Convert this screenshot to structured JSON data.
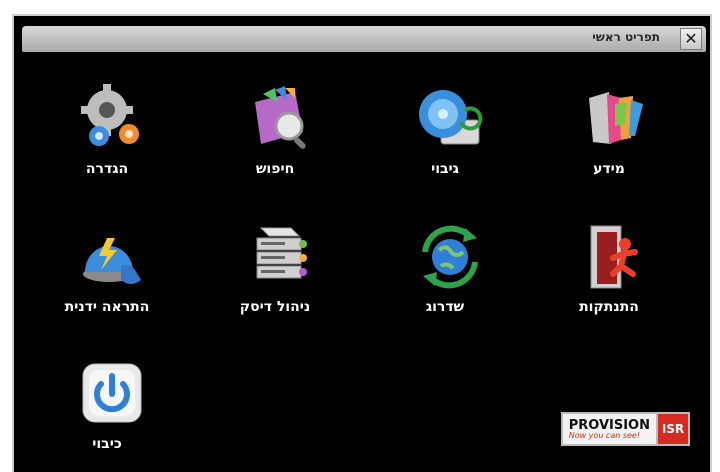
{
  "window": {
    "title": "תפריט ראשי",
    "close_glyph": "✕"
  },
  "menu": {
    "info": {
      "label": "מידע",
      "icon": "info-books-icon"
    },
    "backup": {
      "label": "גיבוי",
      "icon": "backup-disc-icon"
    },
    "search": {
      "label": "חיפוש",
      "icon": "search-magnifier-icon"
    },
    "settings": {
      "label": "הגדרה",
      "icon": "settings-gears-icon"
    },
    "logout": {
      "label": "התנתקות",
      "icon": "logout-door-icon"
    },
    "upgrade": {
      "label": "שדרוג",
      "icon": "upgrade-globe-icon"
    },
    "disk": {
      "label": "ניהול דיסק",
      "icon": "disk-management-icon"
    },
    "alarm": {
      "label": "התראה ידנית",
      "icon": "manual-alarm-icon"
    },
    "shutdown": {
      "label": "כיבוי",
      "icon": "power-icon"
    }
  },
  "brand": {
    "name": "PROVISION",
    "suffix": "ISR",
    "tagline": "Now you can see!"
  }
}
